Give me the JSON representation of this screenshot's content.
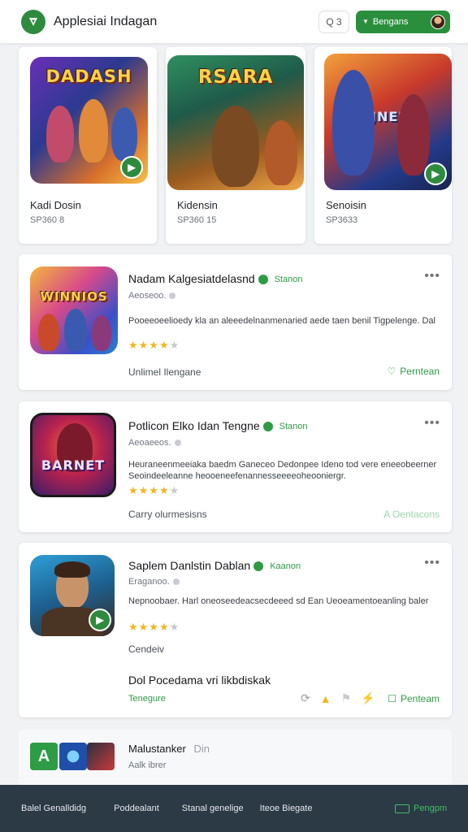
{
  "header": {
    "title": "Applesiai Indagan",
    "search_label": "Q 3",
    "account_label": "Bengans"
  },
  "featured": [
    {
      "art_title": "DADASH",
      "name": "Kadi Dosin",
      "sub": "SP360 8"
    },
    {
      "art_title": "RSARA",
      "name": "Kidensin",
      "sub": "SP360 15"
    },
    {
      "art_title": "ZJNEIA",
      "name": "Senoisin",
      "sub": "SP3633"
    }
  ],
  "apps": [
    {
      "art_title": "WINNIOS",
      "name": "Nadam Kalgesiatdelasnd",
      "status": "Stanon",
      "meta": "Aeoseoo.",
      "desc": "Pooeeoeelioedy kla an aleeedelnanmenaried aede taen benil Tigpelenge. Dal",
      "rating": 4,
      "category": "Unlimel Ilengane",
      "action": "Perntean"
    },
    {
      "art_title": "BARNET",
      "name": "Potlicon Elko Idan Tengne",
      "status": "Stanon",
      "meta": "Aeoaeeos.",
      "desc": "Heuraneenmeeiaka baedm Ganeceo Dedonpee Ideno tod vere eneeobeerner Seoindeeleanne heooeneefenannesseeeeoheooniergr.",
      "rating": 4,
      "category": "Carry olurmesisns",
      "action": "A Oentacons"
    },
    {
      "art_title": "",
      "name": "Saplem Danlstin Dablan",
      "status": "Kaanon",
      "meta": "Eraganoo.",
      "desc": "Nepnoobaer. Harl oneoseedeacsecdeeed sd Ean Ueoeamentoeanling baler",
      "rating": 4,
      "category": "Cendeiv",
      "section_title": "Dol Pocedama vri likbdiskak",
      "section_sub": "Tenegure",
      "action": "Penteam"
    }
  ],
  "mini_row": {
    "name": "Malustanker",
    "name_tag": "Din",
    "sub": "Aalk ibrer"
  },
  "bottom_nav": [
    "Balel Genalldidg",
    "Poddealant",
    "Stanal genelige",
    "Iteoe Biegate",
    "Pengpm"
  ],
  "colors": {
    "accent": "#2e9b45",
    "nav_bg": "#2c3a46",
    "star": "#f2b51f"
  }
}
